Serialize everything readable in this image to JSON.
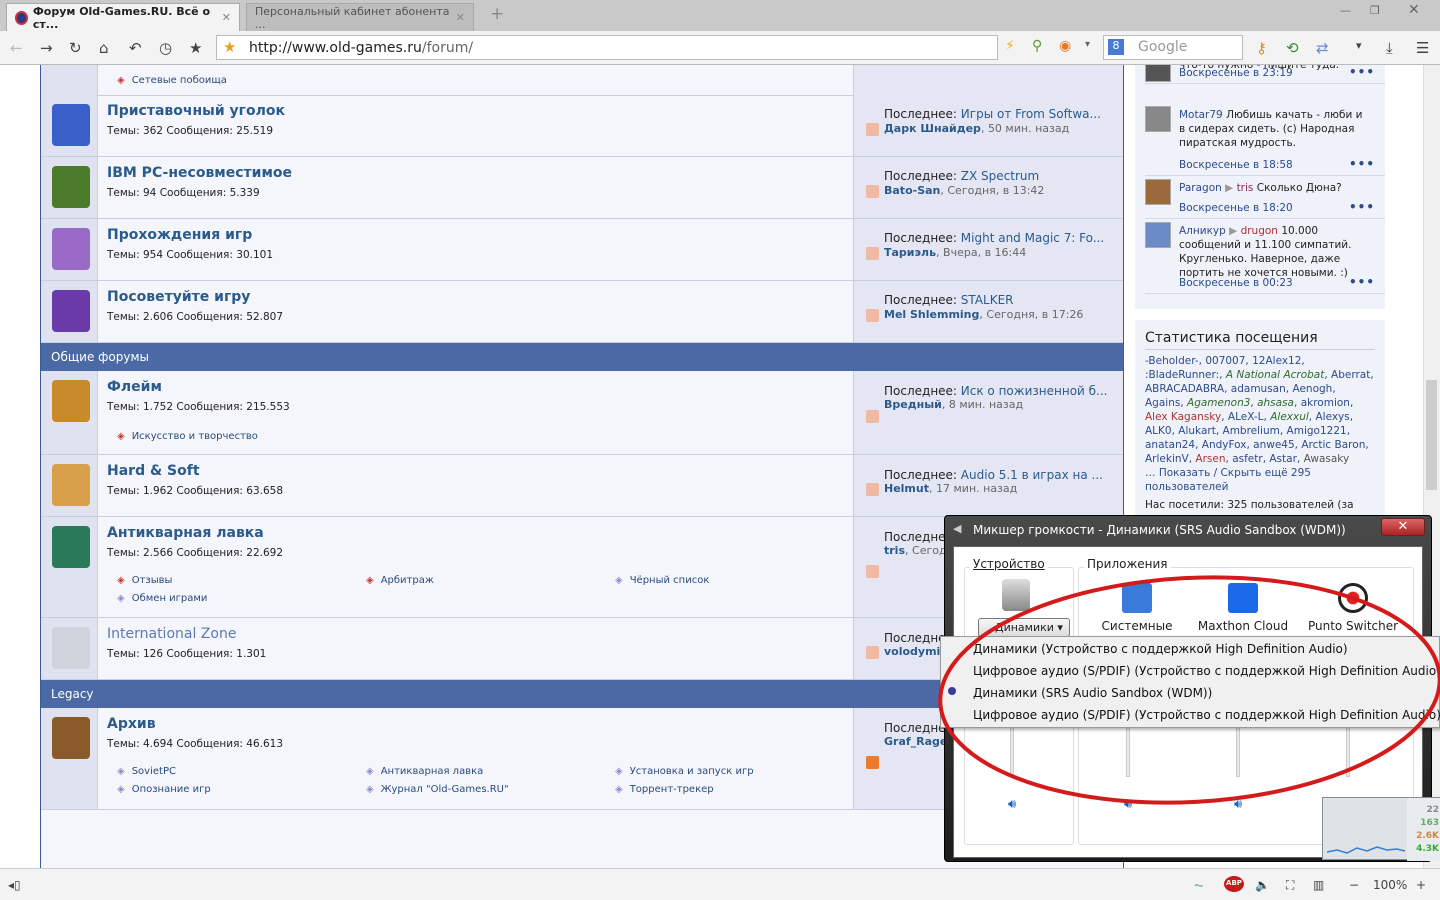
{
  "browser": {
    "tabs": [
      {
        "title": "Форум Old-Games.RU. Всё о ст..."
      },
      {
        "title": "Персональный кабинет абонента ..."
      }
    ],
    "new_tab": "+",
    "url_domain": "http://www.old-games.ru",
    "url_path": "/forum/",
    "search_placeholder": "Google",
    "zoom": "100%"
  },
  "forum": {
    "stats_label_topics": "Темы:",
    "stats_label_posts": "Сообщения:",
    "last_label": "Последнее:",
    "top_sub": "Сетевые побоища",
    "categories": [
      "Общие форумы",
      "Legacy"
    ],
    "rows": [
      {
        "title": "Приставочный уголок",
        "topics": "362",
        "posts": "25.519",
        "last_title": "Игры от From Softwa...",
        "last_user": "Дарк Шнайдер",
        "last_time": "50 мин. назад",
        "color": "#3a5fc8"
      },
      {
        "title": "IBM PC-несовместимое",
        "topics": "94",
        "posts": "5.339",
        "last_title": "ZX Spectrum",
        "last_user": "Bato-San",
        "last_time": "Сегодня, в 13:42",
        "color": "#4a7a2a"
      },
      {
        "title": "Прохождения игр",
        "topics": "954",
        "posts": "30.101",
        "last_title": "Might and Magic 7: Fo...",
        "last_user": "Тариэль",
        "last_time": "Вчера, в 16:44",
        "color": "#9a6ac8"
      },
      {
        "title": "Посоветуйте игру",
        "topics": "2.606",
        "posts": "52.807",
        "last_title": "STALKER",
        "last_user": "Mel Shlemming",
        "last_time": "Сегодня, в 17:26",
        "color": "#6a3aa8"
      },
      {
        "title": "Флейм",
        "topics": "1.752",
        "posts": "215.553",
        "last_title": "Иск о пожизненной б...",
        "last_user": "Вредный",
        "last_time": "8 мин. назад",
        "color": "#c88a2a",
        "subs": [
          "Искусство и творчество"
        ]
      },
      {
        "title": "Hard & Soft",
        "topics": "1.962",
        "posts": "63.658",
        "last_title": "Audio 5.1 в играх на ...",
        "last_user": "Helmut",
        "last_time": "17 мин. назад",
        "color": "#d8a04a"
      },
      {
        "title": "Антикварная лавка",
        "topics": "2.566",
        "posts": "22.692",
        "last_title": "",
        "last_user": "tris",
        "last_time": "Сегод",
        "color": "#2a7a5a",
        "subs": [
          "Отзывы",
          "Арбитраж",
          "Чёрный список",
          "Обмен играми"
        ]
      },
      {
        "title": "International Zone",
        "topics": "126",
        "posts": "1.301",
        "last_title": "",
        "last_user": "volodymi",
        "last_time": "",
        "color": "#d0d4dc"
      },
      {
        "title": "Архив",
        "topics": "4.694",
        "posts": "46.613",
        "last_title": "",
        "last_user": "Graf_Rage",
        "last_time": "",
        "color": "#8a5a2a",
        "subs": [
          "SovietPC",
          "Антикварная лавка",
          "Установка и запуск игр",
          "Опознание игр",
          "Журнал \"Old-Games.RU\"",
          "Торрент-трекер"
        ]
      }
    ]
  },
  "sidebar": {
    "items": [
      {
        "user": "",
        "to": "",
        "text": "что-то нужно - пишите туда.",
        "date": "Воскресенье в 23:19"
      },
      {
        "user": "Motar79",
        "to": "",
        "text": "Любишь качать - люби и в сидерах сидеть. (c) Народная пиратская мудрость.",
        "date": "Воскресенье в 18:58"
      },
      {
        "user": "Paragon",
        "to": "tris",
        "text": "Сколько Дюна?",
        "date": "Воскресенье в 18:20"
      },
      {
        "user": "Алникур",
        "to": "drugon",
        "text": "10.000 сообщений и 11.100 симпатий. Кругленько. Наверное, даже портить не хочется новыми. :)",
        "date": "Воскресенье в 00:23"
      }
    ],
    "more": "•••"
  },
  "visits": {
    "title": "Статистика посещения",
    "names": [
      "-Beholder-",
      "007007",
      "12Alex12",
      ":BladeRunner:",
      "A National Acrobat",
      "Aberrat",
      "ABRACADABRA",
      "adamusan",
      "Aenogh",
      "Agains",
      "Agamenon3",
      "ahsasa",
      "akromion",
      "Alex Kagansky",
      "ALeX-L",
      "Alexxul",
      "Alexys",
      "ALK0",
      "Alukart",
      "Ambrelium",
      "Amigo1221",
      "anatan24",
      "AndyFox",
      "anwe45",
      "Arctic Baron",
      "ArlekinV",
      "Arsen",
      "asfetr",
      "Astar",
      "Awasaky"
    ],
    "show_more": "Показать / Скрыть ещё 295 пользователей",
    "visited": "Нас посетили: 325 пользователей (за"
  },
  "mixer": {
    "title": "Микшер громкости - Динамики (SRS Audio Sandbox (WDM))",
    "close": "✕",
    "device_label": "Устройство",
    "apps_label": "Приложения",
    "device_button": "Динамики",
    "apps": [
      "Системные звуки",
      "Maxthon Cloud",
      "Punto Switcher"
    ],
    "menu": [
      "Динамики (Устройство с поддержкой High Definition Audio)",
      "Цифровое аудио (S/PDIF) (Устройство с поддержкой High Definition Audio)",
      "Динамики (SRS Audio Sandbox (WDM))",
      "Цифровое аудио (S/PDIF) (Устройство с поддержкой High Definition Audio)"
    ],
    "selected_index": 2
  },
  "tray": {
    "values": [
      "22",
      "163",
      "2.6K",
      "4.3K"
    ]
  },
  "colors": {
    "accent": "#4a69a5",
    "link": "#2b5a8c",
    "annotation": "#d41a1a"
  }
}
